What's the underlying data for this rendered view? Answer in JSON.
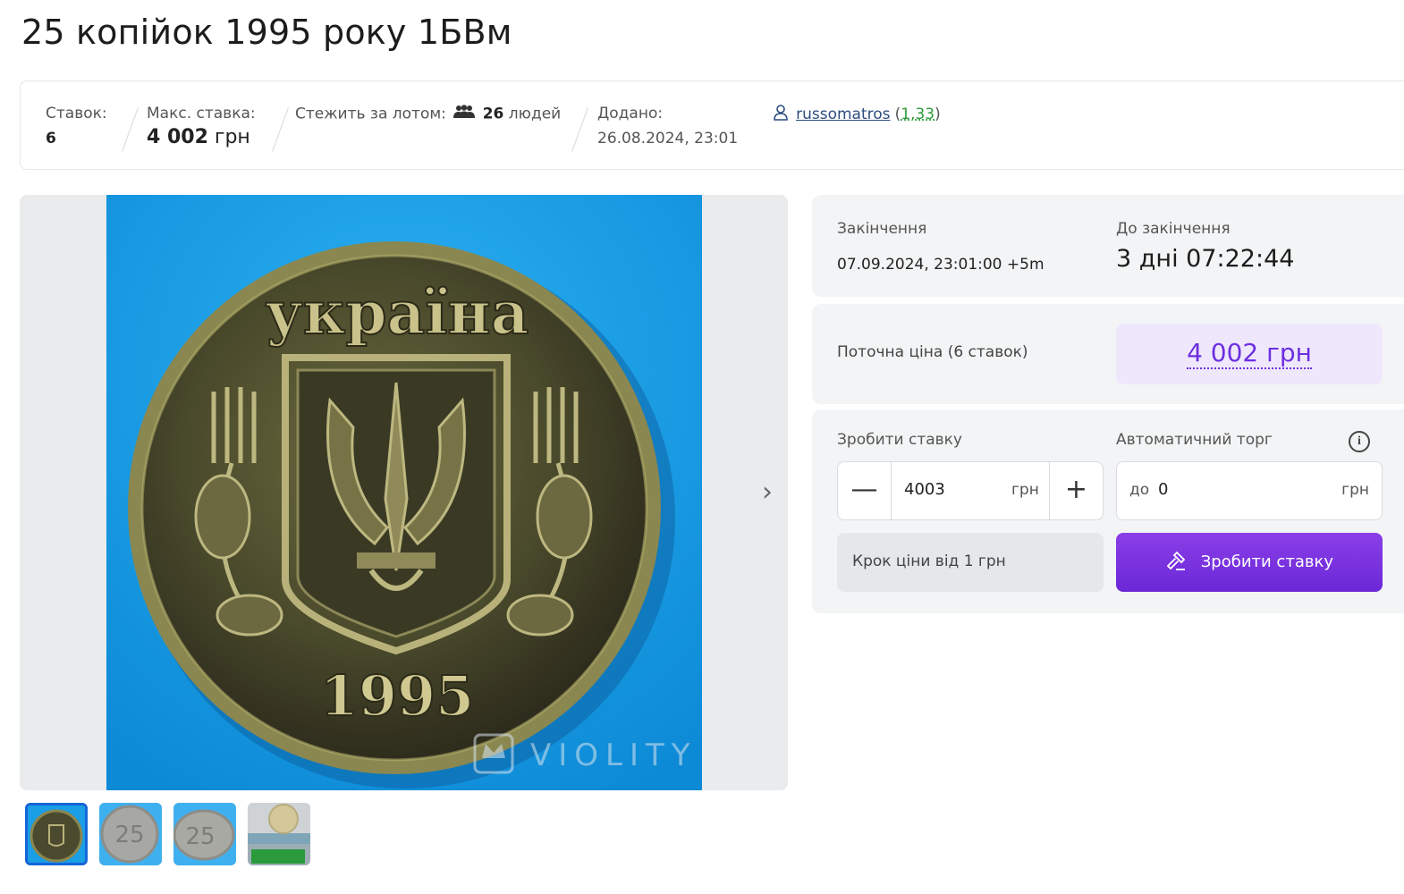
{
  "page": {
    "title": "25 копійок 1995 року 1БВм"
  },
  "stats": {
    "bids_label": "Ставок:",
    "bids_value": "6",
    "max_bid_label": "Макс. ставка:",
    "max_bid_amount": "4 002",
    "max_bid_currency": "грн",
    "watch_label": "Стежить за лотом:",
    "watch_icon": "people-icon",
    "watch_count": "26",
    "watch_suffix": "людей",
    "added_label": "Додано:",
    "added_value": "26.08.2024, 23:01",
    "seller_icon": "user-icon",
    "seller_name": "russomatros",
    "seller_rating": "1,33",
    "rating_open": "(",
    "rating_close": ")"
  },
  "gallery": {
    "coin_inscription": "україна",
    "coin_year": "1995",
    "watermark": "VIOLITY",
    "next_icon": "chevron-right-icon",
    "next_glyph": "›",
    "thumbnails": [
      {
        "label": "thumb-1",
        "active": true
      },
      {
        "label": "thumb-2",
        "active": false
      },
      {
        "label": "thumb-3",
        "active": false
      },
      {
        "label": "thumb-4",
        "active": false
      }
    ]
  },
  "timing": {
    "end_label": "Закінчення",
    "end_value": "07.09.2024, 23:01:00 +5m",
    "remaining_label": "До закінчення",
    "remaining_value": "3 дні 07:22:44"
  },
  "price": {
    "label": "Поточна ціна (6 ставок)",
    "value": "4 002 грн"
  },
  "bid": {
    "label": "Зробити ставку",
    "minus": "—",
    "plus": "+",
    "amount": "4003",
    "unit": "грн",
    "auto_label": "Автоматичний торг",
    "auto_prefix": "до",
    "auto_value": "0",
    "auto_unit": "грн",
    "info_glyph": "i",
    "step_note": "Крок ціни від 1 грн",
    "button_label": "Зробити ставку",
    "button_icon": "gavel-icon"
  },
  "colors": {
    "accent": "#7b35e0",
    "price_bg": "#efe8fd",
    "link": "#2c4c7f",
    "rating": "#2e9b38",
    "thumb_active_border": "#1565d8"
  }
}
